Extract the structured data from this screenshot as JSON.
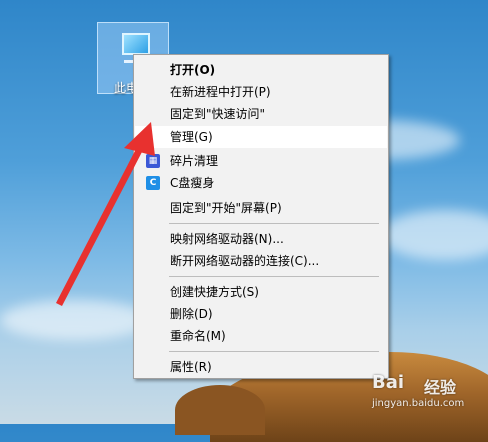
{
  "desktop": {
    "this_pc_label": "此电脑"
  },
  "context_menu": {
    "items": [
      {
        "label": "打开(O)",
        "bold": true
      },
      {
        "label": "在新进程中打开(P)"
      },
      {
        "label": "固定到\"快速访问\""
      },
      {
        "label": "管理(G)",
        "highlighted": true
      },
      {
        "label": "碎片清理",
        "icon": "defrag-icon"
      },
      {
        "label": "C盘瘦身",
        "icon": "c-drive-slim-icon"
      },
      {
        "label": "固定到\"开始\"屏幕(P)"
      },
      {
        "label": "映射网络驱动器(N)..."
      },
      {
        "label": "断开网络驱动器的连接(C)..."
      },
      {
        "label": "创建快捷方式(S)"
      },
      {
        "label": "删除(D)"
      },
      {
        "label": "重命名(M)"
      },
      {
        "label": "属性(R)"
      }
    ]
  },
  "watermark": {
    "logo": "Bai",
    "text": "经验",
    "url": "jingyan.baidu.com"
  },
  "colors": {
    "arrow": "#e8312f",
    "menu_bg": "#f2f2f2",
    "highlight": "#ffffff"
  }
}
